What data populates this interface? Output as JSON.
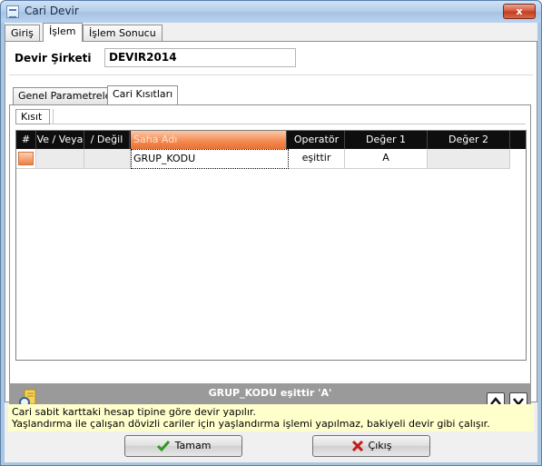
{
  "window": {
    "title": "Cari Devir",
    "close_label": "x"
  },
  "top_tabs": [
    {
      "label": "Giriş"
    },
    {
      "label": "İşlem"
    },
    {
      "label": "İşlem Sonucu"
    }
  ],
  "devir": {
    "label": "Devir Şirketi",
    "value": "DEVIR2014"
  },
  "inner_tabs": [
    {
      "label": "Genel Parametreler"
    },
    {
      "label": "Cari Kısıtları"
    }
  ],
  "kisit_tab": {
    "label": "Kısıt"
  },
  "grid": {
    "columns": [
      "#",
      "Ve / Veya",
      "/ Değil",
      "Saha Adı",
      "Operatör",
      "Değer 1",
      "Değer 2"
    ],
    "rows": [
      {
        "ve_veya": "",
        "degil": "",
        "saha_adi": "GRUP_KODU",
        "operator": "eşittir",
        "deger1": "A",
        "deger2": ""
      }
    ]
  },
  "summary": {
    "text": "GRUP_KODU eşittir 'A'"
  },
  "info": {
    "line1": "Cari sabit karttaki hesap tipine göre devir yapılır.",
    "line2": "Yaşlandırma ile çalışan dövizli cariler için yaşlandırma işlemi yapılmaz, bakiyeli devir gibi çalışır."
  },
  "buttons": {
    "ok": "Tamam",
    "exit": "Çıkış"
  },
  "colors": {
    "grid_header": "#0e0e0e",
    "active_column": "#f3884e",
    "summary_bar": "#9a9a9a",
    "info_background": "#ffffcc",
    "ok_icon": "#2e9a1e",
    "exit_icon": "#c41a1a"
  },
  "icons": [
    "close-icon",
    "search-icon",
    "arrow-up-icon",
    "arrow-down-icon",
    "checkmark-icon",
    "x-icon"
  ]
}
